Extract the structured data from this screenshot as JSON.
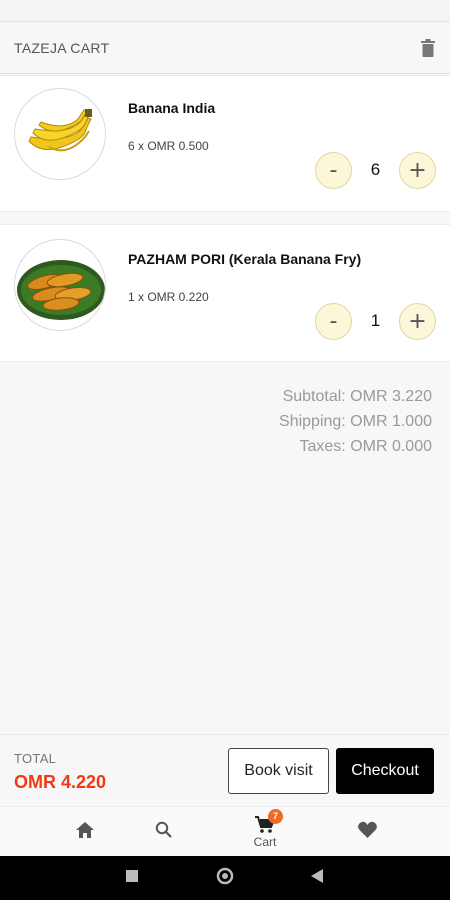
{
  "header": {
    "title": "TAZEJA CART",
    "trash_icon": "trash-icon"
  },
  "items": [
    {
      "name": "Banana India",
      "price_line": "6 x OMR 0.500",
      "quantity": "6",
      "minus": "-",
      "plus": "+",
      "image": "banana-bunch"
    },
    {
      "name": "PAZHAM PORI (Kerala Banana Fry)",
      "price_line": "1 x OMR 0.220",
      "quantity": "1",
      "minus": "-",
      "plus": "+",
      "image": "fried-banana-fritters"
    }
  ],
  "totals": {
    "subtotal": "Subtotal: OMR 3.220",
    "shipping": "Shipping: OMR 1.000",
    "taxes": "Taxes: OMR 0.000"
  },
  "footer": {
    "total_label": "TOTAL",
    "total_amount": "OMR 4.220",
    "book_visit": "Book visit",
    "checkout": "Checkout"
  },
  "bottom_nav": {
    "items": [
      {
        "icon": "home-icon",
        "label": ""
      },
      {
        "icon": "search-icon",
        "label": ""
      },
      {
        "icon": "cart-icon",
        "label": "Cart",
        "badge": "7"
      },
      {
        "icon": "heart-icon",
        "label": ""
      }
    ]
  },
  "colors": {
    "accent": "#ef3b15",
    "badge": "#f26922",
    "stepper_bg": "#fbf7d8",
    "checkout_bg": "#000000"
  }
}
